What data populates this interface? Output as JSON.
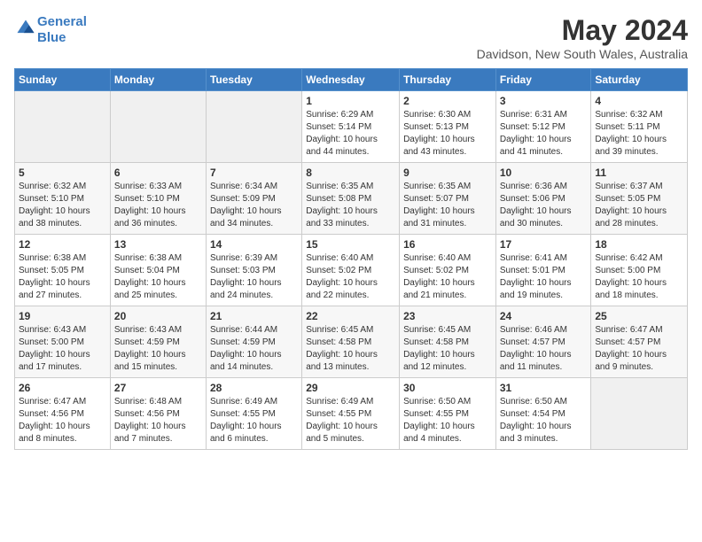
{
  "logo": {
    "line1": "General",
    "line2": "Blue"
  },
  "title": "May 2024",
  "location": "Davidson, New South Wales, Australia",
  "days_header": [
    "Sunday",
    "Monday",
    "Tuesday",
    "Wednesday",
    "Thursday",
    "Friday",
    "Saturday"
  ],
  "weeks": [
    [
      {
        "num": "",
        "info": ""
      },
      {
        "num": "",
        "info": ""
      },
      {
        "num": "",
        "info": ""
      },
      {
        "num": "1",
        "info": "Sunrise: 6:29 AM\nSunset: 5:14 PM\nDaylight: 10 hours\nand 44 minutes."
      },
      {
        "num": "2",
        "info": "Sunrise: 6:30 AM\nSunset: 5:13 PM\nDaylight: 10 hours\nand 43 minutes."
      },
      {
        "num": "3",
        "info": "Sunrise: 6:31 AM\nSunset: 5:12 PM\nDaylight: 10 hours\nand 41 minutes."
      },
      {
        "num": "4",
        "info": "Sunrise: 6:32 AM\nSunset: 5:11 PM\nDaylight: 10 hours\nand 39 minutes."
      }
    ],
    [
      {
        "num": "5",
        "info": "Sunrise: 6:32 AM\nSunset: 5:10 PM\nDaylight: 10 hours\nand 38 minutes."
      },
      {
        "num": "6",
        "info": "Sunrise: 6:33 AM\nSunset: 5:10 PM\nDaylight: 10 hours\nand 36 minutes."
      },
      {
        "num": "7",
        "info": "Sunrise: 6:34 AM\nSunset: 5:09 PM\nDaylight: 10 hours\nand 34 minutes."
      },
      {
        "num": "8",
        "info": "Sunrise: 6:35 AM\nSunset: 5:08 PM\nDaylight: 10 hours\nand 33 minutes."
      },
      {
        "num": "9",
        "info": "Sunrise: 6:35 AM\nSunset: 5:07 PM\nDaylight: 10 hours\nand 31 minutes."
      },
      {
        "num": "10",
        "info": "Sunrise: 6:36 AM\nSunset: 5:06 PM\nDaylight: 10 hours\nand 30 minutes."
      },
      {
        "num": "11",
        "info": "Sunrise: 6:37 AM\nSunset: 5:05 PM\nDaylight: 10 hours\nand 28 minutes."
      }
    ],
    [
      {
        "num": "12",
        "info": "Sunrise: 6:38 AM\nSunset: 5:05 PM\nDaylight: 10 hours\nand 27 minutes."
      },
      {
        "num": "13",
        "info": "Sunrise: 6:38 AM\nSunset: 5:04 PM\nDaylight: 10 hours\nand 25 minutes."
      },
      {
        "num": "14",
        "info": "Sunrise: 6:39 AM\nSunset: 5:03 PM\nDaylight: 10 hours\nand 24 minutes."
      },
      {
        "num": "15",
        "info": "Sunrise: 6:40 AM\nSunset: 5:02 PM\nDaylight: 10 hours\nand 22 minutes."
      },
      {
        "num": "16",
        "info": "Sunrise: 6:40 AM\nSunset: 5:02 PM\nDaylight: 10 hours\nand 21 minutes."
      },
      {
        "num": "17",
        "info": "Sunrise: 6:41 AM\nSunset: 5:01 PM\nDaylight: 10 hours\nand 19 minutes."
      },
      {
        "num": "18",
        "info": "Sunrise: 6:42 AM\nSunset: 5:00 PM\nDaylight: 10 hours\nand 18 minutes."
      }
    ],
    [
      {
        "num": "19",
        "info": "Sunrise: 6:43 AM\nSunset: 5:00 PM\nDaylight: 10 hours\nand 17 minutes."
      },
      {
        "num": "20",
        "info": "Sunrise: 6:43 AM\nSunset: 4:59 PM\nDaylight: 10 hours\nand 15 minutes."
      },
      {
        "num": "21",
        "info": "Sunrise: 6:44 AM\nSunset: 4:59 PM\nDaylight: 10 hours\nand 14 minutes."
      },
      {
        "num": "22",
        "info": "Sunrise: 6:45 AM\nSunset: 4:58 PM\nDaylight: 10 hours\nand 13 minutes."
      },
      {
        "num": "23",
        "info": "Sunrise: 6:45 AM\nSunset: 4:58 PM\nDaylight: 10 hours\nand 12 minutes."
      },
      {
        "num": "24",
        "info": "Sunrise: 6:46 AM\nSunset: 4:57 PM\nDaylight: 10 hours\nand 11 minutes."
      },
      {
        "num": "25",
        "info": "Sunrise: 6:47 AM\nSunset: 4:57 PM\nDaylight: 10 hours\nand 9 minutes."
      }
    ],
    [
      {
        "num": "26",
        "info": "Sunrise: 6:47 AM\nSunset: 4:56 PM\nDaylight: 10 hours\nand 8 minutes."
      },
      {
        "num": "27",
        "info": "Sunrise: 6:48 AM\nSunset: 4:56 PM\nDaylight: 10 hours\nand 7 minutes."
      },
      {
        "num": "28",
        "info": "Sunrise: 6:49 AM\nSunset: 4:55 PM\nDaylight: 10 hours\nand 6 minutes."
      },
      {
        "num": "29",
        "info": "Sunrise: 6:49 AM\nSunset: 4:55 PM\nDaylight: 10 hours\nand 5 minutes."
      },
      {
        "num": "30",
        "info": "Sunrise: 6:50 AM\nSunset: 4:55 PM\nDaylight: 10 hours\nand 4 minutes."
      },
      {
        "num": "31",
        "info": "Sunrise: 6:50 AM\nSunset: 4:54 PM\nDaylight: 10 hours\nand 3 minutes."
      },
      {
        "num": "",
        "info": ""
      }
    ]
  ]
}
